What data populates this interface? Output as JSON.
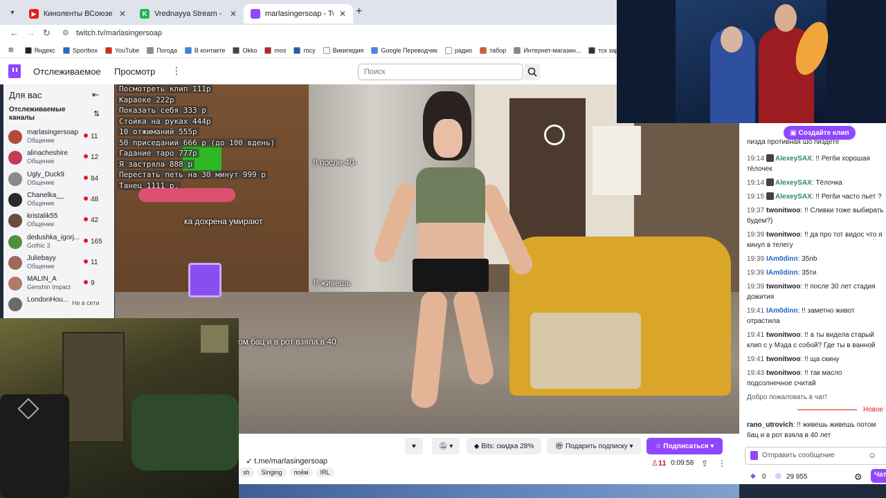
{
  "browser": {
    "tabs": [
      {
        "title": "Киноленты ВСоюзе — смотре",
        "favicon_color": "#e62117",
        "active": false
      },
      {
        "title": "Vrednayya Stream - Watch Live",
        "favicon_color": "#1db954",
        "active": false
      },
      {
        "title": "marlasingersoap - Twitch",
        "favicon_color": "#9146ff",
        "active": true
      }
    ],
    "url": "twitch.tv/marlasingersoap",
    "bookmarks": [
      {
        "label": "Яндекс",
        "color": "#222222"
      },
      {
        "label": "Sportbox",
        "color": "#1a6fc9"
      },
      {
        "label": "YouTube",
        "color": "#e62117"
      },
      {
        "label": "Погода",
        "color": "#8c8c8c"
      },
      {
        "label": "В контакте",
        "color": "#2787f5"
      },
      {
        "label": "Okko",
        "color": "#444444"
      },
      {
        "label": "mos",
        "color": "#c21f30"
      },
      {
        "label": "госу",
        "color": "#1f5fb5"
      },
      {
        "label": "Википедия",
        "color": "#ffffff"
      },
      {
        "label": "Google Переводчик",
        "color": "#4285f4"
      },
      {
        "label": "радио",
        "color": "#ffffff"
      },
      {
        "label": "табор",
        "color": "#e5533b"
      },
      {
        "label": "Интернет-магазин...",
        "color": "#888888"
      },
      {
        "label": "тск заря",
        "color": "#333333"
      }
    ]
  },
  "twitch": {
    "nav": {
      "following": "Отслеживаемое",
      "browse": "Просмотр"
    },
    "search_placeholder": "Поиск",
    "colors": {
      "brand": "#9146ff",
      "live": "#e91916"
    }
  },
  "sidebar": {
    "title": "Для вас",
    "followed_label": "Отслеживаемые каналы",
    "channels": [
      {
        "name": "marlasingersoap",
        "category": "Общение",
        "viewers": "11",
        "avatar": "#b44a3a"
      },
      {
        "name": "alinacheshire",
        "category": "Общение",
        "viewers": "12",
        "avatar": "#c23c5a"
      },
      {
        "name": "Ugly_Duck9",
        "category": "Общение",
        "viewers": "84",
        "avatar": "#8a8a8a"
      },
      {
        "name": "Chanelka__",
        "category": "Общение",
        "viewers": "48",
        "avatar": "#2b2b2b"
      },
      {
        "name": "kristalik55",
        "category": "Общение",
        "viewers": "42",
        "avatar": "#6b4b3b"
      },
      {
        "name": "dedushka_igorj...",
        "category": "Gothic 3",
        "viewers": "165",
        "avatar": "#4f8f3f"
      },
      {
        "name": "Juliebayy",
        "category": "Общение",
        "viewers": "11",
        "avatar": "#9b6a5a"
      },
      {
        "name": "MALIN_A",
        "category": "Genshin Impact",
        "viewers": "9",
        "avatar": "#b07a6a"
      },
      {
        "name": "LondonHou...",
        "category": "",
        "viewers": "",
        "offline": "Не в сети",
        "avatar": "#6a6a6a"
      }
    ]
  },
  "stream": {
    "overlay_items": [
      "Посмотреть клип 111р",
      "Караоке 222р",
      "Показать себя 333 р",
      "Стойка на руках 444р",
      "10 отжиманий 555р",
      "50 приседаний 666 р (до 100 вдень)",
      "Гадание таро 777р",
      "Я застряла 888 р",
      "Перестать петь на 30 минут 999 р",
      "Танец 1111 р."
    ],
    "captions": [
      "!! после 40-",
      "ка дохрена умирают",
      "!! живешь",
      "ом бац и в рот взяла в 40"
    ],
    "link": "t.me/marlasingersoap",
    "tags": [
      "sh",
      "Singing",
      "поём",
      "IRL"
    ],
    "bits_label": "Bits: скидка 28%",
    "gift_label": "Подарить подписку",
    "subscribe_label": "Подписаться",
    "viewers": "11",
    "uptime": "0:09:58"
  },
  "chat": {
    "clip_button": "Создайте клип",
    "cut_text": "пизда противная шо пиздете",
    "messages": [
      {
        "time": "19:14",
        "user": "AlexeySAX",
        "color": "#2e8b57",
        "badge": true,
        "text": "!! Регби хорошая тёлочек"
      },
      {
        "time": "19:14",
        "user": "AlexeySAX",
        "color": "#2e8b57",
        "badge": true,
        "text": "Тёлочка"
      },
      {
        "time": "19:15",
        "user": "AlexeySAX",
        "color": "#2e8b57",
        "badge": true,
        "text": "!! Регби часто пьет ?"
      },
      {
        "time": "19:37",
        "user": "twonitwoo",
        "color": "#1f1f23",
        "badge": false,
        "text": "!! Сливки тоже выбирать будем?)"
      },
      {
        "time": "19:39",
        "user": "twonitwoo",
        "color": "#1f1f23",
        "badge": false,
        "text": "!! да про тот видос что я кинул в телегу"
      },
      {
        "time": "19:39",
        "user": "IAm0dinn",
        "color": "#1e66c8",
        "badge": false,
        "text": "35nb"
      },
      {
        "time": "19:39",
        "user": "IAm0dinn",
        "color": "#1e66c8",
        "badge": false,
        "text": "35ти"
      },
      {
        "time": "19:39",
        "user": "twonitwoo",
        "color": "#1f1f23",
        "badge": false,
        "text": "!! после 30 лет стадия дожития"
      },
      {
        "time": "19:41",
        "user": "IAm0dinn",
        "color": "#1e66c8",
        "badge": false,
        "text": "!! заметно живот отрастила"
      },
      {
        "time": "19:41",
        "user": "twonitwoo",
        "color": "#1f1f23",
        "badge": false,
        "text": "!! а ты видела старый клип с у Мэда с собой? Где ты в ванной"
      },
      {
        "time": "19:41",
        "user": "twonitwoo",
        "color": "#1f1f23",
        "badge": false,
        "text": "!! ща скину"
      },
      {
        "time": "19:43",
        "user": "twonitwoo",
        "color": "#1f1f23",
        "badge": false,
        "text": "!! так масло подсолнечное считай"
      }
    ],
    "welcome": "Добро пожаловать в чат!",
    "new_label": "Новое",
    "last_message": {
      "user": "rano_utrovich",
      "text": "!! живешь живешь потом бац и в рот взяла в 40 лет"
    },
    "input_placeholder": "Отправить сообщение",
    "points": "0",
    "channel_points": "29 855",
    "send_label": "Чат"
  }
}
